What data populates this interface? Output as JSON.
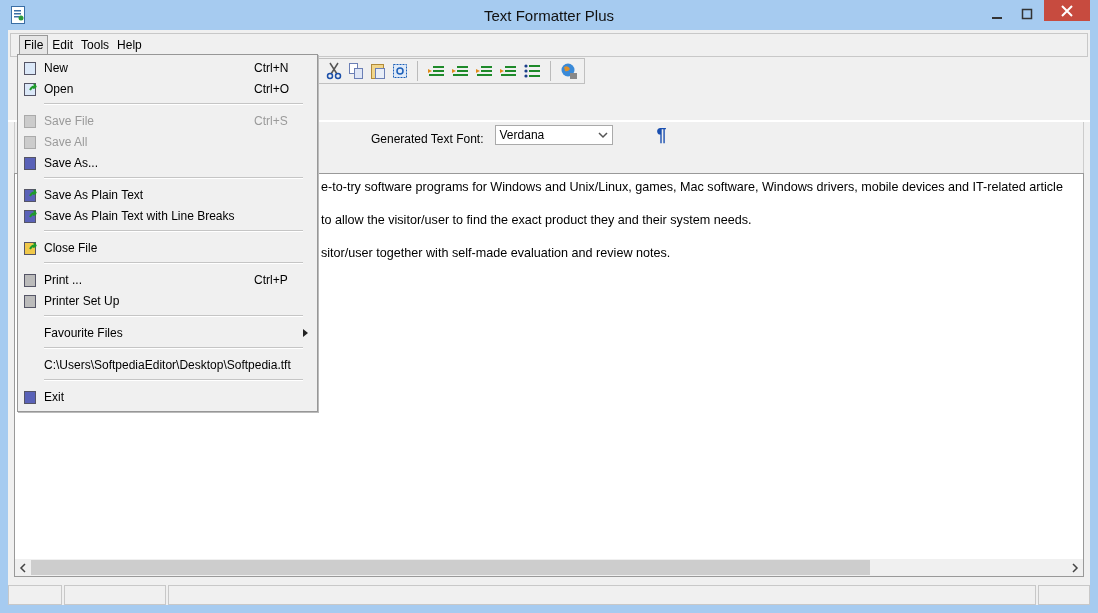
{
  "window": {
    "title": "Text Formatter Plus"
  },
  "menu_bar": [
    {
      "label": "File",
      "selected": true
    },
    {
      "label": "Edit",
      "selected": false
    },
    {
      "label": "Tools",
      "selected": false
    },
    {
      "label": "Help",
      "selected": false
    }
  ],
  "file_menu": [
    {
      "kind": "item",
      "label": "New",
      "shortcut": "Ctrl+N",
      "disabled": false
    },
    {
      "kind": "item",
      "label": "Open",
      "shortcut": "Ctrl+O",
      "disabled": false
    },
    {
      "kind": "separator"
    },
    {
      "kind": "item",
      "label": "Save File",
      "shortcut": "Ctrl+S",
      "disabled": true
    },
    {
      "kind": "item",
      "label": "Save All",
      "disabled": true
    },
    {
      "kind": "item",
      "label": "Save As...",
      "disabled": false
    },
    {
      "kind": "separator"
    },
    {
      "kind": "item",
      "label": "Save As Plain Text",
      "disabled": false
    },
    {
      "kind": "item",
      "label": "Save As Plain Text with Line Breaks",
      "disabled": false
    },
    {
      "kind": "separator"
    },
    {
      "kind": "item",
      "label": "Close File",
      "disabled": false
    },
    {
      "kind": "separator"
    },
    {
      "kind": "item",
      "label": "Print ...",
      "shortcut": "Ctrl+P",
      "disabled": false
    },
    {
      "kind": "item",
      "label": "Printer Set Up",
      "disabled": false
    },
    {
      "kind": "separator"
    },
    {
      "kind": "submenu",
      "label": "Favourite Files",
      "disabled": false
    },
    {
      "kind": "separator"
    },
    {
      "kind": "item",
      "label": "C:\\Users\\SoftpediaEditor\\Desktop\\Softpedia.tft",
      "disabled": false
    },
    {
      "kind": "separator"
    },
    {
      "kind": "item",
      "label": "Exit",
      "disabled": false
    }
  ],
  "font_panel": {
    "label": "Generated Text Font:",
    "font": "Verdana",
    "pilcrow": "¶"
  },
  "text_lines": [
    "e-to-try software programs for Windows and Unix/Linux, games, Mac software, Windows drivers, mobile devices and IT-related article",
    "to allow the visitor/user to find the exact product they and their system needs.",
    "sitor/user together with self-made evaluation and review notes."
  ]
}
